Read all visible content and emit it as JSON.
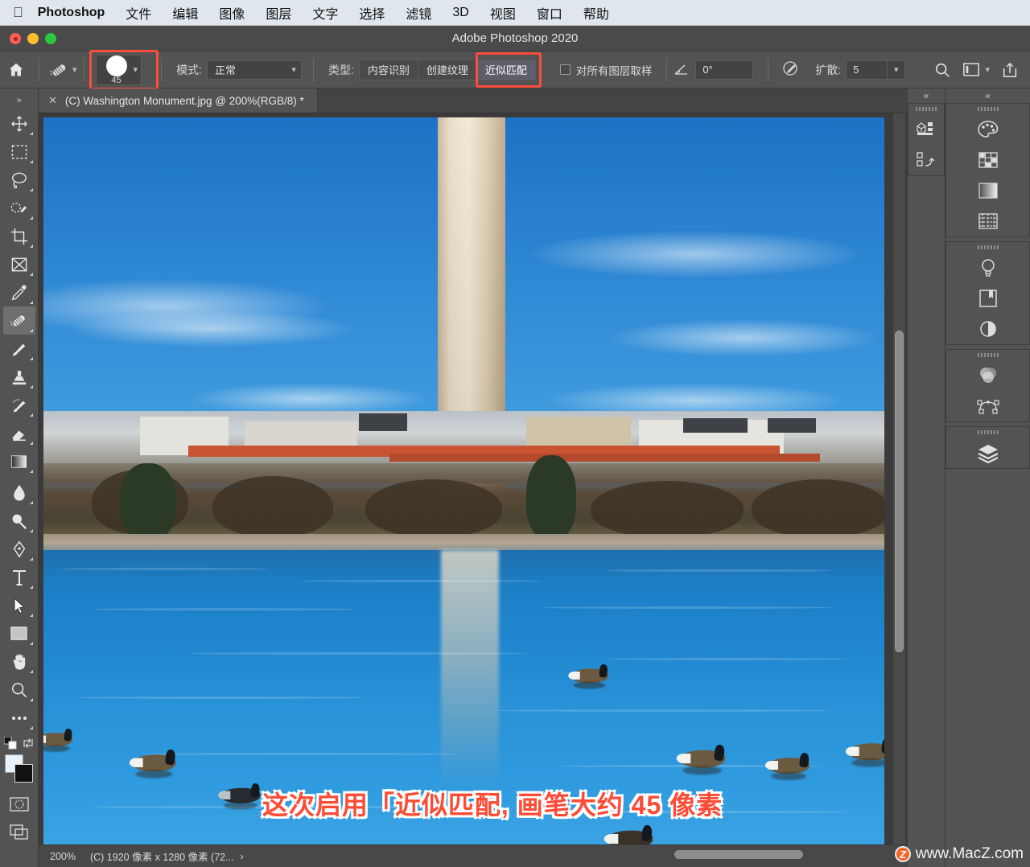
{
  "menubar": {
    "apple_icon": "apple-logo-icon",
    "items": [
      {
        "label": "Photoshop",
        "bold": true
      },
      {
        "label": "文件"
      },
      {
        "label": "编辑"
      },
      {
        "label": "图像"
      },
      {
        "label": "图层"
      },
      {
        "label": "文字"
      },
      {
        "label": "选择"
      },
      {
        "label": "滤镜"
      },
      {
        "label": "3D"
      },
      {
        "label": "视图"
      },
      {
        "label": "窗口"
      },
      {
        "label": "帮助"
      }
    ]
  },
  "window": {
    "title": "Adobe Photoshop 2020"
  },
  "options_bar": {
    "home_icon": "home-icon",
    "tool_icon": "spot-healing-brush-icon",
    "brush_size": "45",
    "mode_label": "模式:",
    "mode_value": "正常",
    "type_label": "类型:",
    "type_buttons": [
      {
        "label": "内容识别",
        "active": false
      },
      {
        "label": "创建纹理",
        "active": false
      },
      {
        "label": "近似匹配",
        "active": true
      }
    ],
    "sample_all_layers_label": "对所有图层取样",
    "sample_all_layers_checked": false,
    "angle_value": "0°",
    "pressure_icon": "pressure-toggle-icon",
    "diffusion_label": "扩散:",
    "diffusion_value": "5",
    "search_icon": "search-icon",
    "workspace_icon": "workspace-switcher-icon",
    "share_icon": "share-icon",
    "highlight_color": "#ff4b3e"
  },
  "toolbar": {
    "tools": [
      {
        "name": "move-tool",
        "glyph": "move",
        "selected": false
      },
      {
        "name": "rectangular-marquee-tool",
        "glyph": "marquee",
        "selected": false
      },
      {
        "name": "lasso-tool",
        "glyph": "lasso",
        "selected": false
      },
      {
        "name": "object-selection-tool",
        "glyph": "quickselect",
        "selected": false
      },
      {
        "name": "crop-tool",
        "glyph": "crop",
        "selected": false
      },
      {
        "name": "frame-tool",
        "glyph": "frame",
        "selected": false
      },
      {
        "name": "eyedropper-tool",
        "glyph": "eyedropper",
        "selected": false
      },
      {
        "name": "spot-healing-brush-tool",
        "glyph": "healing",
        "selected": true
      },
      {
        "name": "brush-tool",
        "glyph": "brush",
        "selected": false
      },
      {
        "name": "clone-stamp-tool",
        "glyph": "stamp",
        "selected": false
      },
      {
        "name": "history-brush-tool",
        "glyph": "historybrush",
        "selected": false
      },
      {
        "name": "eraser-tool",
        "glyph": "eraser",
        "selected": false
      },
      {
        "name": "gradient-tool",
        "glyph": "gradient",
        "selected": false
      },
      {
        "name": "blur-tool",
        "glyph": "blur",
        "selected": false
      },
      {
        "name": "dodge-tool",
        "glyph": "dodge",
        "selected": false
      },
      {
        "name": "pen-tool",
        "glyph": "pen",
        "selected": false
      },
      {
        "name": "type-tool",
        "glyph": "type",
        "selected": false
      },
      {
        "name": "path-selection-tool",
        "glyph": "pathselect",
        "selected": false
      },
      {
        "name": "rectangle-tool",
        "glyph": "rectangle",
        "selected": false
      },
      {
        "name": "hand-tool",
        "glyph": "hand",
        "selected": false
      },
      {
        "name": "zoom-tool",
        "glyph": "zoom",
        "selected": false
      },
      {
        "name": "edit-toolbar",
        "glyph": "ellipsis",
        "selected": false
      }
    ],
    "foreground_color": "#e8f2fa",
    "background_color": "#111111",
    "quickmask_icon": "quick-mask-icon",
    "screenmode_icon": "screen-mode-icon"
  },
  "document": {
    "tab_label": "(C) Washington Monument.jpg @ 200%(RGB/8) *",
    "close_icon": "close-icon"
  },
  "status_bar": {
    "zoom": "200%",
    "doc_info": "(C) 1920 像素 x 1280 像素 (72...",
    "chevron": "›"
  },
  "annotation": {
    "text": "这次启用「近似匹配, 画笔大约 45 像素",
    "color": "#fd4b35"
  },
  "watermark": {
    "badge": "Z",
    "text": "www.MacZ.com"
  },
  "right_panels": {
    "collapse_icon": "collapse-panel-icon",
    "column_a": [
      {
        "name": "3d-panel-icon"
      },
      {
        "name": "3d-mesh-panel-icon"
      }
    ],
    "column_b_group1": [
      {
        "name": "color-panel-icon"
      },
      {
        "name": "swatches-panel-icon"
      },
      {
        "name": "gradients-panel-icon"
      },
      {
        "name": "patterns-panel-icon"
      }
    ],
    "column_b_group2": [
      {
        "name": "adjustments-panel-icon"
      },
      {
        "name": "libraries-panel-icon"
      },
      {
        "name": "styles-panel-icon"
      }
    ],
    "column_b_group3": [
      {
        "name": "channels-panel-icon"
      },
      {
        "name": "paths-panel-icon"
      }
    ],
    "column_b_group4": [
      {
        "name": "layers-panel-icon"
      }
    ]
  },
  "image_scene": {
    "description": "Washington Monument over Tidal Basin with geese"
  }
}
